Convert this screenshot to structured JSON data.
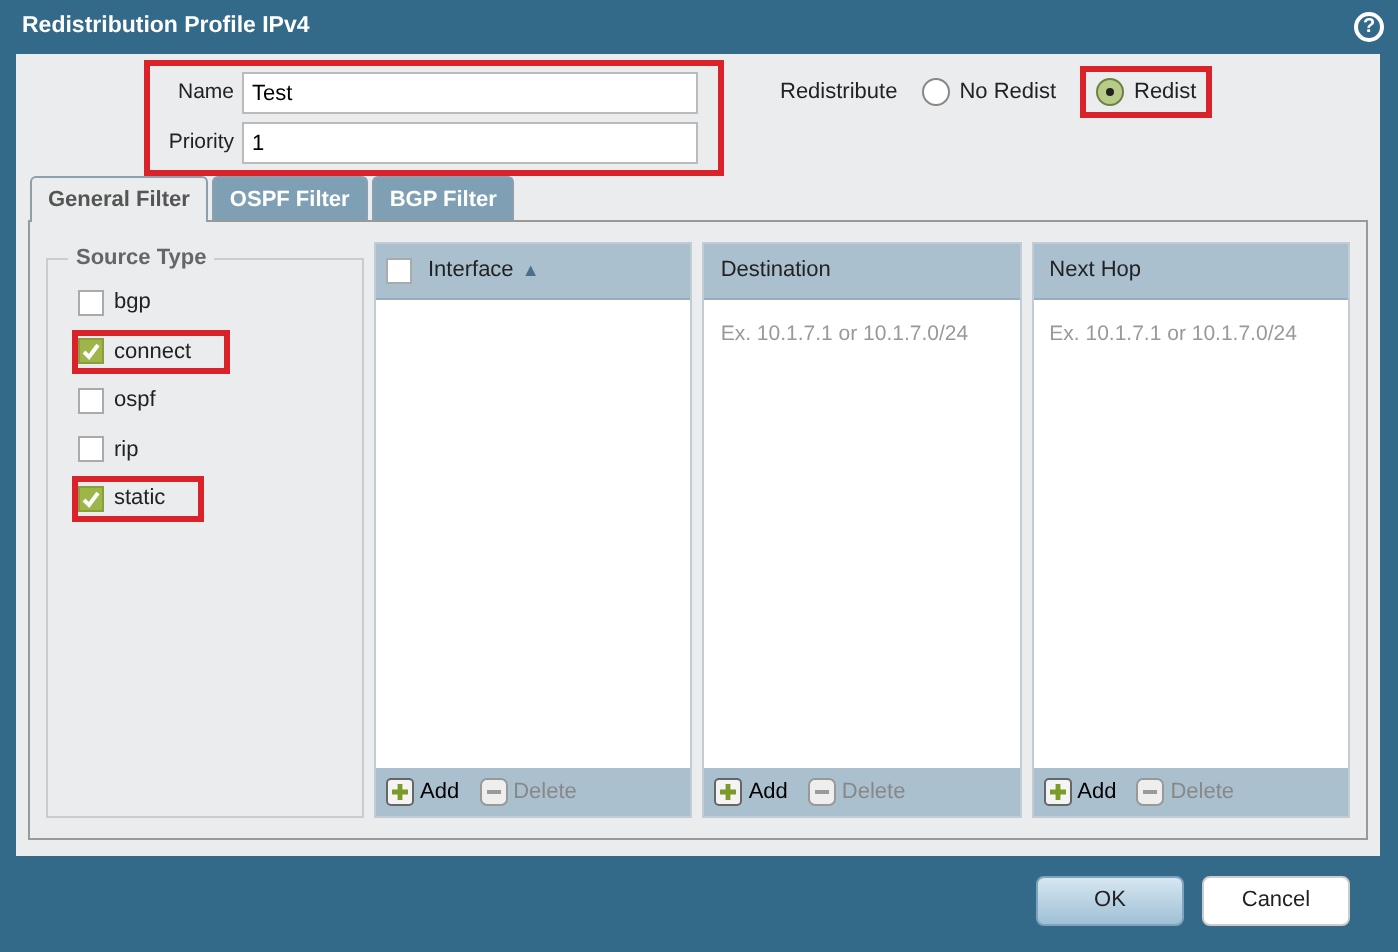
{
  "window": {
    "title": "Redistribution Profile IPv4",
    "help": "?"
  },
  "fields": {
    "highlighted": true,
    "items": [
      {
        "label": "Name",
        "value": "Test"
      },
      {
        "label": "Priority",
        "value": "1"
      }
    ]
  },
  "redistribute": {
    "label": "Redistribute",
    "options": [
      {
        "label": "No Redist",
        "selected": false,
        "highlighted": false
      },
      {
        "label": "Redist",
        "selected": true,
        "highlighted": true
      }
    ]
  },
  "tabs": [
    {
      "label": "General Filter",
      "selected": true
    },
    {
      "label": "OSPF Filter",
      "selected": false
    },
    {
      "label": "BGP Filter",
      "selected": false
    }
  ],
  "source_type": {
    "title": "Source Type",
    "items": [
      {
        "label": "bgp",
        "checked": false,
        "highlighted": false
      },
      {
        "label": "connect",
        "checked": true,
        "highlighted": true
      },
      {
        "label": "ospf",
        "checked": false,
        "highlighted": false
      },
      {
        "label": "rip",
        "checked": false,
        "highlighted": false
      },
      {
        "label": "static",
        "checked": true,
        "highlighted": true
      }
    ]
  },
  "grids": [
    {
      "header": "Interface",
      "select_all": false,
      "sort": "▲",
      "add": "Add",
      "delete": "Delete"
    },
    {
      "header": "Destination",
      "placeholder": "Ex. 10.1.7.1 or 10.1.7.0/24",
      "add": "Add",
      "delete": "Delete"
    },
    {
      "header": "Next Hop",
      "placeholder": "Ex. 10.1.7.1 or 10.1.7.0/24",
      "add": "Add",
      "delete": "Delete"
    }
  ],
  "buttons": [
    {
      "label": "OK",
      "kind": "primary"
    },
    {
      "label": "Cancel",
      "kind": "secondary"
    }
  ]
}
